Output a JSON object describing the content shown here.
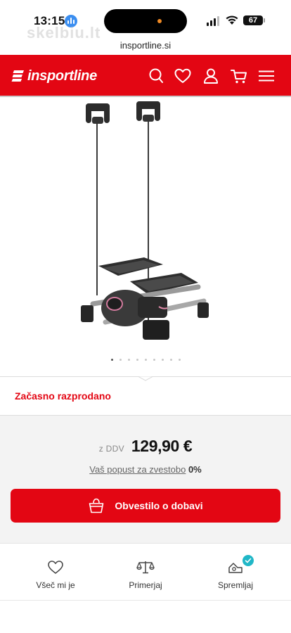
{
  "status_bar": {
    "time": "13:15",
    "battery": "67",
    "watermark": "skelbiu.lt"
  },
  "browser": {
    "url": "insportline.si"
  },
  "header": {
    "logo_text": "insportline",
    "icons": [
      "search-icon",
      "heart-icon",
      "user-icon",
      "cart-icon",
      "menu-icon"
    ],
    "brand_color": "#e30613"
  },
  "gallery": {
    "image": "stepper-with-resistance-bands",
    "slide_count": 9,
    "active_slide": 1
  },
  "availability": {
    "status": "Začasno razprodano"
  },
  "pricing": {
    "vat_label": "z DDV",
    "price": "129,90 €",
    "discount_label": "Vaš popust za zvestobo",
    "discount_value": "0%"
  },
  "notify_button": {
    "label": "Obvestilo o dobavi"
  },
  "actions": {
    "like": "Všeč mi je",
    "compare": "Primerjaj",
    "follow": "Spremljaj"
  }
}
